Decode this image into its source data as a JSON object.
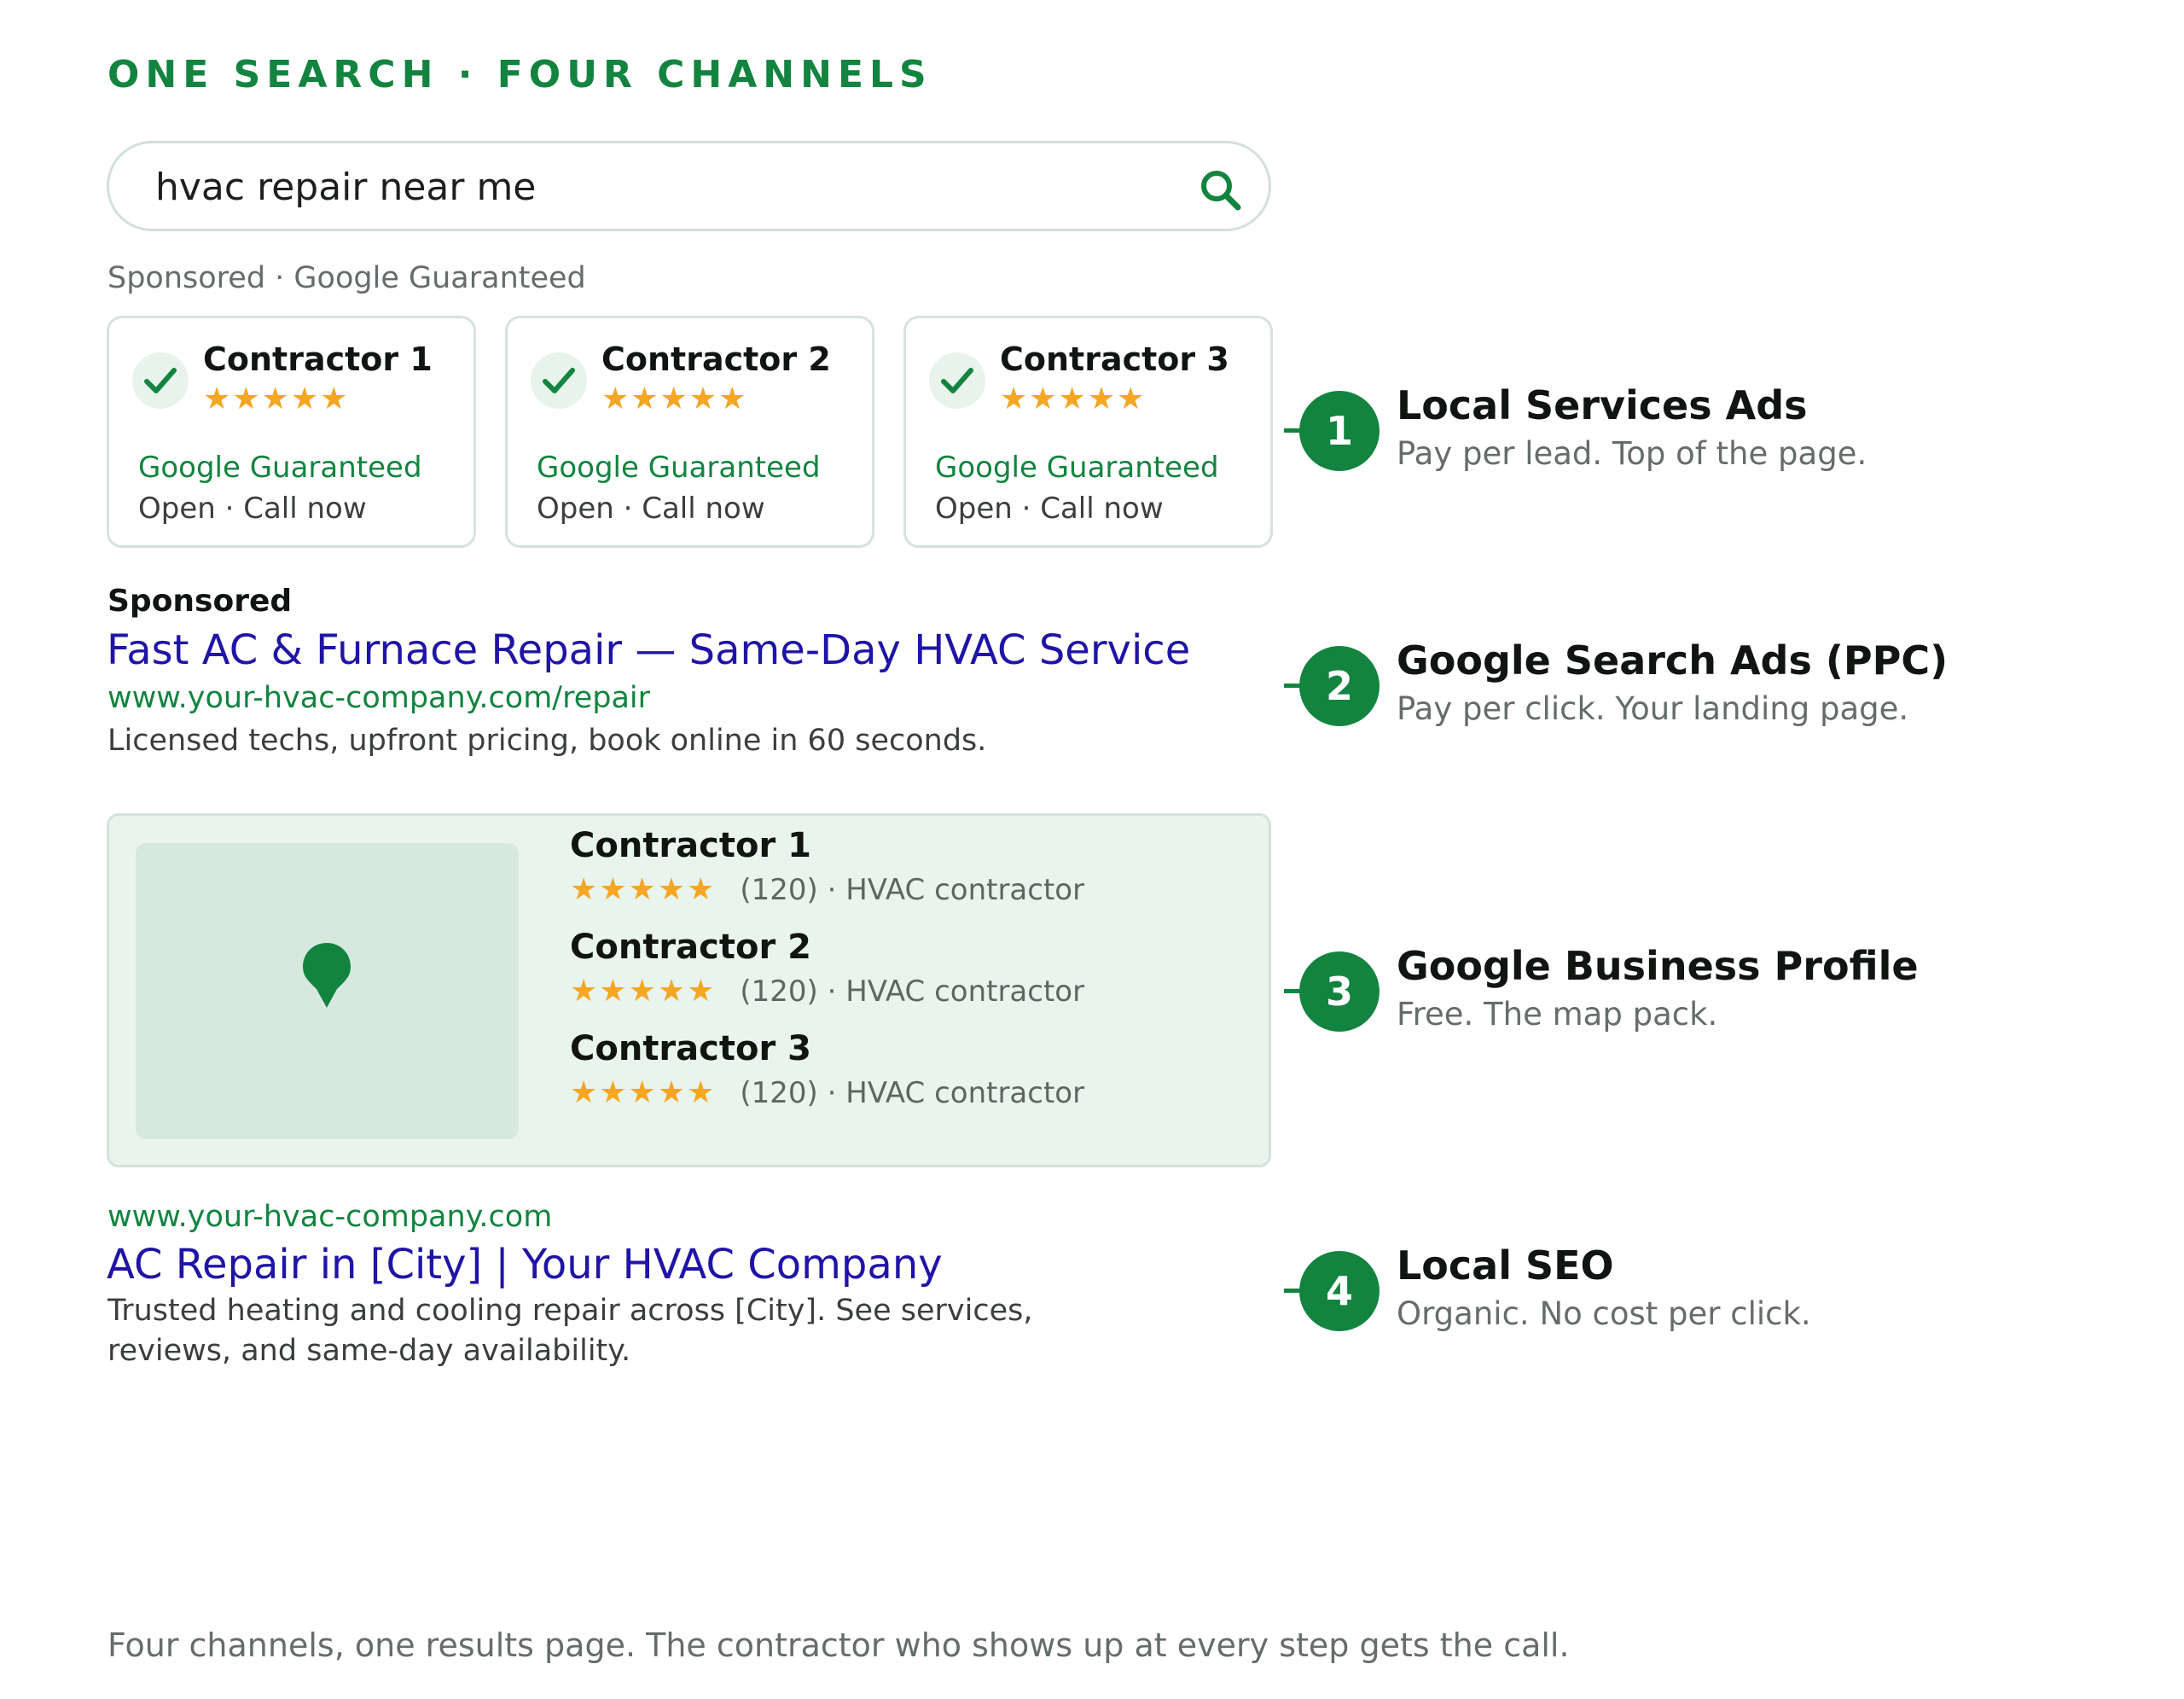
{
  "heading": "ONE SEARCH · FOUR CHANNELS",
  "search": {
    "query": "hvac repair near me",
    "icon": "search-icon"
  },
  "lsa": {
    "label": "Sponsored · Google Guaranteed",
    "cards": [
      {
        "name": "Contractor 1",
        "stars": "★★★★★",
        "badge": "Google Guaranteed",
        "status": "Open · Call now"
      },
      {
        "name": "Contractor 2",
        "stars": "★★★★★",
        "badge": "Google Guaranteed",
        "status": "Open · Call now"
      },
      {
        "name": "Contractor 3",
        "stars": "★★★★★",
        "badge": "Google Guaranteed",
        "status": "Open · Call now"
      }
    ]
  },
  "ppc": {
    "label": "Sponsored",
    "title": "Fast AC & Furnace Repair — Same-Day HVAC Service",
    "url": "www.your-hvac-company.com/repair",
    "description": "Licensed techs, upfront pricing, book online in 60 seconds."
  },
  "map_pack": {
    "listings": [
      {
        "name": "Contractor 1",
        "stars": "★★★★★",
        "meta": "(120) · HVAC contractor"
      },
      {
        "name": "Contractor 2",
        "stars": "★★★★★",
        "meta": "(120) · HVAC contractor"
      },
      {
        "name": "Contractor 3",
        "stars": "★★★★★",
        "meta": "(120) · HVAC contractor"
      }
    ]
  },
  "organic": {
    "url": "www.your-hvac-company.com",
    "title": "AC Repair in [City] | Your HVAC Company",
    "description_line1": "Trusted heating and cooling repair across [City]. See services,",
    "description_line2": "reviews, and same-day availability."
  },
  "callouts": [
    {
      "number": "1",
      "title": "Local Services Ads",
      "subtitle": "Pay per lead. Top of the page."
    },
    {
      "number": "2",
      "title": "Google Search Ads (PPC)",
      "subtitle": "Pay per click. Your landing page."
    },
    {
      "number": "3",
      "title": "Google Business Profile",
      "subtitle": "Free. The map pack."
    },
    {
      "number": "4",
      "title": "Local SEO",
      "subtitle": "Organic. No cost per click."
    }
  ],
  "footer": "Four channels, one results page. The contractor who shows up at every step gets the call.",
  "colors": {
    "brand_green": "#12843f",
    "link_blue": "#1f14a6",
    "star_orange": "#f5a623",
    "map_bg": "#e9f4ee"
  }
}
